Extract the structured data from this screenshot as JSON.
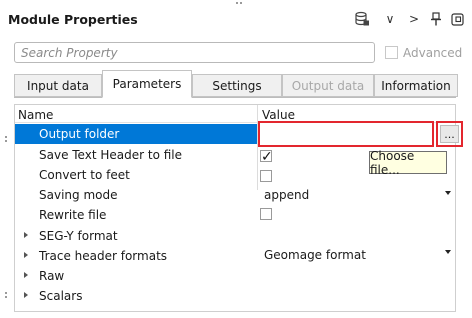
{
  "window": {
    "title": "Module Properties"
  },
  "toolbar": {
    "icons": [
      "database-icon",
      "chevron-down-icon",
      "chevron-right-icon",
      "pin-icon",
      "popout-icon"
    ],
    "down": "∨",
    "right": ">"
  },
  "search": {
    "placeholder": "Search Property",
    "value": ""
  },
  "advanced": {
    "label": "Advanced",
    "checked": false
  },
  "tabs": [
    {
      "label": "Input data",
      "active": false,
      "disabled": false
    },
    {
      "label": "Parameters",
      "active": true,
      "disabled": false
    },
    {
      "label": "Settings",
      "active": false,
      "disabled": false
    },
    {
      "label": "Output data",
      "active": false,
      "disabled": true
    },
    {
      "label": "Information",
      "active": false,
      "disabled": false
    }
  ],
  "grid": {
    "headers": {
      "name": "Name",
      "value": "Value"
    },
    "rows": [
      {
        "name": "Output folder",
        "value": "",
        "type": "text",
        "selected": true
      },
      {
        "name": "Save Text Header to file",
        "value": "✓",
        "type": "checkbox",
        "checked": true
      },
      {
        "name": "Convert to feet",
        "value": "",
        "type": "checkbox",
        "checked": false
      },
      {
        "name": "Saving mode",
        "value": "append",
        "type": "dropdown"
      },
      {
        "name": "Rewrite file",
        "value": "",
        "type": "checkbox",
        "checked": false
      },
      {
        "name": "SEG-Y format",
        "value": "",
        "type": "group"
      },
      {
        "name": "Trace header formats",
        "value": "Geomage format",
        "type": "group-dropdown"
      },
      {
        "name": "Raw",
        "value": "",
        "type": "group"
      },
      {
        "name": "Scalars",
        "value": "",
        "type": "group"
      }
    ],
    "browse_label": "...",
    "tooltip": "Choose file..."
  },
  "colors": {
    "selection": "#0078d7",
    "highlight_box": "#e3262e",
    "tooltip_bg": "#ffffe1"
  }
}
